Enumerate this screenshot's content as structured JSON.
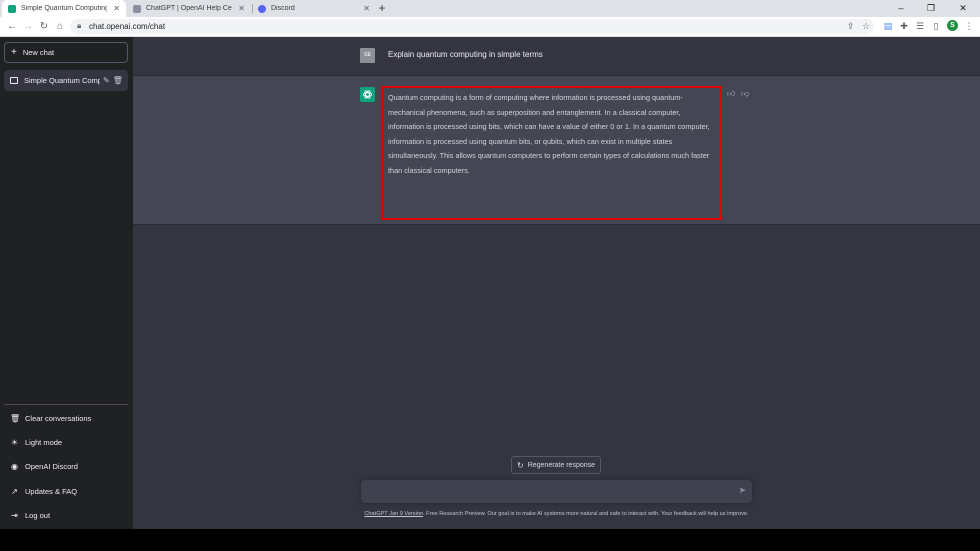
{
  "browser": {
    "tabs": [
      {
        "title": "Simple Quantum Computing Exp",
        "favicon_color": "#10a37f"
      },
      {
        "title": "ChatGPT | OpenAI Help Center",
        "favicon_color": "#8e8ea0"
      },
      {
        "title": "Discord",
        "favicon_color": "#5865f2"
      }
    ],
    "new_tab": "+",
    "url": "chat.openai.com/chat",
    "profile_initial": "S"
  },
  "sidebar": {
    "new_chat": "New chat",
    "conversation": "Simple Quantum Comp",
    "links": [
      {
        "label": "Clear conversations",
        "icon": "trash-icon"
      },
      {
        "label": "Light mode",
        "icon": "sun-icon"
      },
      {
        "label": "OpenAI Discord",
        "icon": "discord-icon"
      },
      {
        "label": "Updates & FAQ",
        "icon": "external-link-icon"
      },
      {
        "label": "Log out",
        "icon": "logout-icon"
      }
    ]
  },
  "chat": {
    "user_initials": "SE",
    "user_message": "Explain quantum computing in simple terms",
    "assistant_message": "Quantum computing is a form of computing where information is processed using quantum-mechanical phenomena, such as superposition and entanglement. In a classical computer, information is processed using bits, which can have a value of either 0 or 1. In a quantum computer, information is processed using quantum bits, or qubits, which can exist in multiple states simultaneously. This allows quantum computers to perform certain types of calculations much faster than classical computers.",
    "regenerate": "Regenerate response",
    "input_placeholder": "",
    "footer_link": "ChatGPT Jan 9 Version",
    "footer_text": ". Free Research Preview. Our goal is to make AI systems more natural and safe to interact with. Your feedback will help us improve."
  },
  "colors": {
    "sidebar_bg": "#202123",
    "main_bg": "#343541",
    "assistant_row_bg": "#444654",
    "highlight_border": "#e00000",
    "brand_green": "#10a37f"
  }
}
